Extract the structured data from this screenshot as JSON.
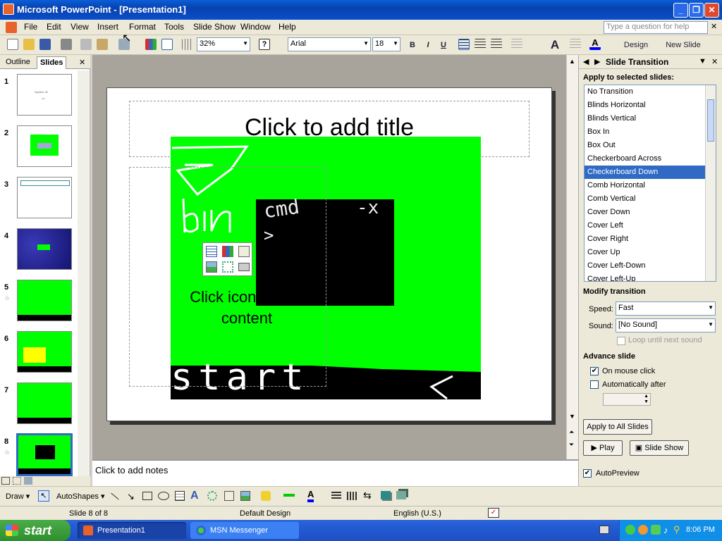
{
  "app": {
    "title": "Microsoft PowerPoint - [Presentation1]",
    "minimize": "_",
    "maximize": "❐",
    "close": "✕"
  },
  "menu": {
    "items": [
      "File",
      "Edit",
      "View",
      "Insert",
      "Format",
      "Tools",
      "Slide Show",
      "Window",
      "Help"
    ],
    "help_placeholder": "Type a question for help",
    "doc_close": "✕"
  },
  "toolbar": {
    "zoom": "32%",
    "font": "Arial",
    "size": "18",
    "bold": "B",
    "italic": "I",
    "underline": "U",
    "grow_font": "A",
    "design": "Design",
    "new_slide": "New Slide"
  },
  "leftpane": {
    "tab_outline": "Outline",
    "tab_slides": "Slides",
    "close": "✕",
    "slide_numbers": [
      "1",
      "2",
      "3",
      "4",
      "5",
      "6",
      "7",
      "8"
    ],
    "slide1_title": "System 32",
    "slide1_sub": "text"
  },
  "slide": {
    "title_placeholder": "Click to add title",
    "content_placeholder": "Click icon to add content",
    "drawn_words": {
      "top": "bin",
      "cmd": "cmd",
      "x": "-x",
      "prompt": ">",
      "bottom": "start",
      "bottom_right": "<"
    }
  },
  "notes": {
    "placeholder": "Click to add notes"
  },
  "taskpane": {
    "title": "Slide Transition",
    "apply_label": "Apply to selected slides:",
    "transitions": [
      "No Transition",
      "Blinds Horizontal",
      "Blinds Vertical",
      "Box In",
      "Box Out",
      "Checkerboard Across",
      "Checkerboard Down",
      "Comb Horizontal",
      "Comb Vertical",
      "Cover Down",
      "Cover Left",
      "Cover Right",
      "Cover Up",
      "Cover Left-Down",
      "Cover Left-Up"
    ],
    "selected_transition": "Checkerboard Down",
    "modify_label": "Modify transition",
    "speed_label": "Speed:",
    "speed_value": "Fast",
    "sound_label": "Sound:",
    "sound_value": "[No Sound]",
    "loop_label": "Loop until next sound",
    "advance_label": "Advance slide",
    "on_click_label": "On mouse click",
    "on_click_checked": true,
    "auto_label": "Automatically after",
    "auto_checked": false,
    "apply_all": "Apply to All Slides",
    "play": "Play",
    "slideshow": "Slide Show",
    "autopreview": "AutoPreview",
    "autopreview_checked": true
  },
  "drawbar": {
    "draw": "Draw ▾",
    "autoshapes": "AutoShapes ▾"
  },
  "status": {
    "slide": "Slide 8 of 8",
    "design": "Default Design",
    "language": "English (U.S.)"
  },
  "taskbar": {
    "start": "start",
    "tasks": [
      "Presentation1",
      "MSN Messenger"
    ],
    "clock": "8:06 PM"
  },
  "colors": {
    "slide_green": "#00ff00",
    "xp_blue": "#0a4ec8",
    "selection": "#316ac5"
  }
}
